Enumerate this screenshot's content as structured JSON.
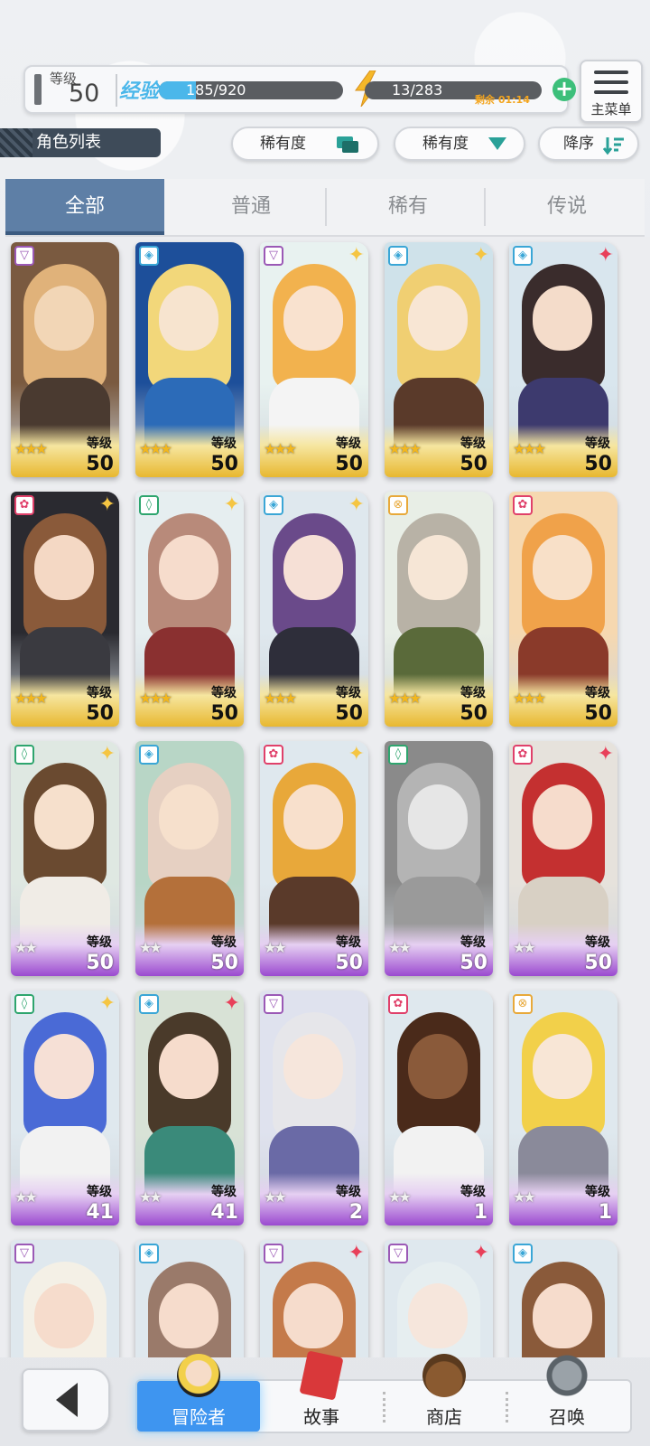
{
  "status": {
    "level_label": "等级",
    "level_value": "50",
    "exp_tag": "经验",
    "exp_text": "185/920",
    "exp_fraction": 0.2,
    "stamina_text": "13/283",
    "stamina_timer": "剩余 01:14",
    "add_symbol": "+"
  },
  "menu": {
    "label": "主菜单"
  },
  "list_title": "角色列表",
  "sort": {
    "filter1": "稀有度",
    "filter2": "稀有度",
    "order": "降序"
  },
  "tabs": [
    "全部",
    "普通",
    "稀有",
    "传说"
  ],
  "cards": [
    {
      "lvl_label": "等级",
      "level": "50",
      "stars": "★★★",
      "frame": "gold",
      "element": "▽",
      "elemcolor": "#9b59b6",
      "spark": "",
      "palette": [
        "#7a5a40",
        "#e0b27a",
        "#f2d6b6",
        "#4a3a30"
      ]
    },
    {
      "lvl_label": "等级",
      "level": "50",
      "stars": "★★★",
      "frame": "gold",
      "element": "◈",
      "elemcolor": "#3aa6d6",
      "spark": "",
      "palette": [
        "#1d4f9a",
        "#f2d77a",
        "#f7e4cf",
        "#2c6bb8"
      ]
    },
    {
      "lvl_label": "等级",
      "level": "50",
      "stars": "★★★",
      "frame": "gold",
      "element": "▽",
      "elemcolor": "#9b59b6",
      "spark": "✦",
      "sparkcolor": "#f5c542",
      "palette": [
        "#e8f2f0",
        "#f2b24e",
        "#f9e2cf",
        "#f4f4f4"
      ]
    },
    {
      "lvl_label": "等级",
      "level": "50",
      "stars": "★★★",
      "frame": "gold",
      "element": "◈",
      "elemcolor": "#3aa6d6",
      "spark": "✦",
      "sparkcolor": "#f5c542",
      "palette": [
        "#cfe2ea",
        "#f0cf72",
        "#f8e6d4",
        "#5a3a2a"
      ]
    },
    {
      "lvl_label": "等级",
      "level": "50",
      "stars": "★★★",
      "frame": "gold",
      "element": "◈",
      "elemcolor": "#3aa6d6",
      "spark": "✦",
      "sparkcolor": "#e8405a",
      "palette": [
        "#d9e6ee",
        "#3a2c2c",
        "#f4dcca",
        "#3d3a6e"
      ]
    },
    {
      "lvl_label": "等级",
      "level": "50",
      "stars": "★★★",
      "frame": "gold",
      "element": "✿",
      "elemcolor": "#e0406a",
      "spark": "✦",
      "sparkcolor": "#f5c542",
      "palette": [
        "#2a2a30",
        "#8a5a3a",
        "#f4d8c4",
        "#3a3a40"
      ]
    },
    {
      "lvl_label": "等级",
      "level": "50",
      "stars": "★★★",
      "frame": "gold",
      "element": "◊",
      "elemcolor": "#2ea56e",
      "spark": "✦",
      "sparkcolor": "#f5c542",
      "palette": [
        "#e6eef0",
        "#b88a7a",
        "#f6dccc",
        "#8a3030"
      ]
    },
    {
      "lvl_label": "等级",
      "level": "50",
      "stars": "★★★",
      "frame": "gold",
      "element": "◈",
      "elemcolor": "#3aa6d6",
      "spark": "✦",
      "sparkcolor": "#f5c542",
      "palette": [
        "#dfe8ee",
        "#6a4a8a",
        "#f6e0d6",
        "#2e2e3a"
      ]
    },
    {
      "lvl_label": "等级",
      "level": "50",
      "stars": "★★★",
      "frame": "gold",
      "element": "⊗",
      "elemcolor": "#e8a93a",
      "spark": "",
      "palette": [
        "#e8eee6",
        "#b8b2a6",
        "#f6e6d6",
        "#5a6a3a"
      ]
    },
    {
      "lvl_label": "等级",
      "level": "50",
      "stars": "★★★",
      "frame": "gold",
      "element": "✿",
      "elemcolor": "#e0406a",
      "spark": "",
      "palette": [
        "#f6d8b0",
        "#f0a24a",
        "#f8e0c8",
        "#8a3a2a"
      ]
    },
    {
      "lvl_label": "等级",
      "level": "50",
      "stars": "★★",
      "frame": "purple",
      "element": "◊",
      "elemcolor": "#2ea56e",
      "spark": "✦",
      "sparkcolor": "#f5c542",
      "palette": [
        "#dfe8e2",
        "#6a4a30",
        "#f6e0cc",
        "#f0ece6"
      ]
    },
    {
      "lvl_label": "等级",
      "level": "50",
      "stars": "★★",
      "frame": "purple",
      "element": "◈",
      "elemcolor": "#3aa6d6",
      "spark": "",
      "palette": [
        "#b8d6c6",
        "#e6d0c2",
        "#f6e0cc",
        "#b4703a"
      ]
    },
    {
      "lvl_label": "等级",
      "level": "50",
      "stars": "★★",
      "frame": "purple",
      "element": "✿",
      "elemcolor": "#e0406a",
      "spark": "✦",
      "sparkcolor": "#f5c542",
      "palette": [
        "#dfe8ee",
        "#e8a83a",
        "#f8e0cc",
        "#5a3a2a"
      ]
    },
    {
      "lvl_label": "等级",
      "level": "50",
      "stars": "★★",
      "frame": "purple",
      "element": "◊",
      "elemcolor": "#2ea56e",
      "spark": "",
      "palette": [
        "#8a8a8a",
        "#b4b4b4",
        "#e6e6e6",
        "#9a9a9a"
      ]
    },
    {
      "lvl_label": "等级",
      "level": "50",
      "stars": "★★",
      "frame": "purple",
      "element": "✿",
      "elemcolor": "#e0406a",
      "spark": "✦",
      "sparkcolor": "#e8405a",
      "palette": [
        "#e6e2dc",
        "#c43030",
        "#f6dccc",
        "#d8d0c4"
      ]
    },
    {
      "lvl_label": "等级",
      "level": "41",
      "stars": "★★",
      "frame": "purple",
      "element": "◊",
      "elemcolor": "#2ea56e",
      "spark": "✦",
      "sparkcolor": "#f5c542",
      "palette": [
        "#dfe8ee",
        "#4a6ad6",
        "#f6e0d6",
        "#f2f2f2"
      ]
    },
    {
      "lvl_label": "等级",
      "level": "41",
      "stars": "★★",
      "frame": "purple",
      "element": "◈",
      "elemcolor": "#3aa6d6",
      "spark": "✦",
      "sparkcolor": "#e8405a",
      "palette": [
        "#d8e2d6",
        "#4a3a2a",
        "#f6dccc",
        "#3a8a7a"
      ]
    },
    {
      "lvl_label": "等级",
      "level": "2",
      "stars": "★★",
      "frame": "purple",
      "element": "▽",
      "elemcolor": "#9b59b6",
      "spark": "",
      "palette": [
        "#dfe2ee",
        "#e6e6ea",
        "#f6e6dc",
        "#6a6aa6"
      ]
    },
    {
      "lvl_label": "等级",
      "level": "1",
      "stars": "★★",
      "frame": "purple",
      "element": "✿",
      "elemcolor": "#e0406a",
      "spark": "",
      "palette": [
        "#dfe8ee",
        "#4a2a1a",
        "#8a5a3a",
        "#f2f2f2"
      ]
    },
    {
      "lvl_label": "等级",
      "level": "1",
      "stars": "★★",
      "frame": "purple",
      "element": "⊗",
      "elemcolor": "#e8a93a",
      "spark": "",
      "palette": [
        "#dfe8ee",
        "#f2d04a",
        "#f8e6d6",
        "#8a8a9a"
      ]
    },
    {
      "lvl_label": "",
      "level": "",
      "stars": "",
      "frame": "none",
      "element": "▽",
      "elemcolor": "#9b59b6",
      "spark": "",
      "palette": [
        "#dfe8ee",
        "#f4f0e6",
        "#f6dccc",
        "#f2f2f2"
      ]
    },
    {
      "lvl_label": "",
      "level": "",
      "stars": "",
      "frame": "none",
      "element": "◈",
      "elemcolor": "#3aa6d6",
      "spark": "",
      "palette": [
        "#dfe8ee",
        "#9a7a6a",
        "#f6dccc",
        "#e6e0da"
      ]
    },
    {
      "lvl_label": "",
      "level": "",
      "stars": "",
      "frame": "none",
      "element": "▽",
      "elemcolor": "#9b59b6",
      "spark": "✦",
      "sparkcolor": "#e8405a",
      "palette": [
        "#dfe8ee",
        "#c47a4a",
        "#f6dccc",
        "#e6e0da"
      ]
    },
    {
      "lvl_label": "",
      "level": "",
      "stars": "",
      "frame": "none",
      "element": "▽",
      "elemcolor": "#9b59b6",
      "spark": "✦",
      "sparkcolor": "#e8405a",
      "palette": [
        "#dfe8ee",
        "#e6eef0",
        "#f6e6dc",
        "#5a9a4a"
      ]
    },
    {
      "lvl_label": "",
      "level": "",
      "stars": "",
      "frame": "none",
      "element": "◈",
      "elemcolor": "#3aa6d6",
      "spark": "",
      "palette": [
        "#dfe8ee",
        "#8a5a3a",
        "#f6dccc",
        "#e6e0da"
      ]
    }
  ],
  "bottom_nav": {
    "items": [
      {
        "label": "冒险者"
      },
      {
        "label": "故事"
      },
      {
        "label": "商店"
      },
      {
        "label": "召唤"
      }
    ]
  }
}
